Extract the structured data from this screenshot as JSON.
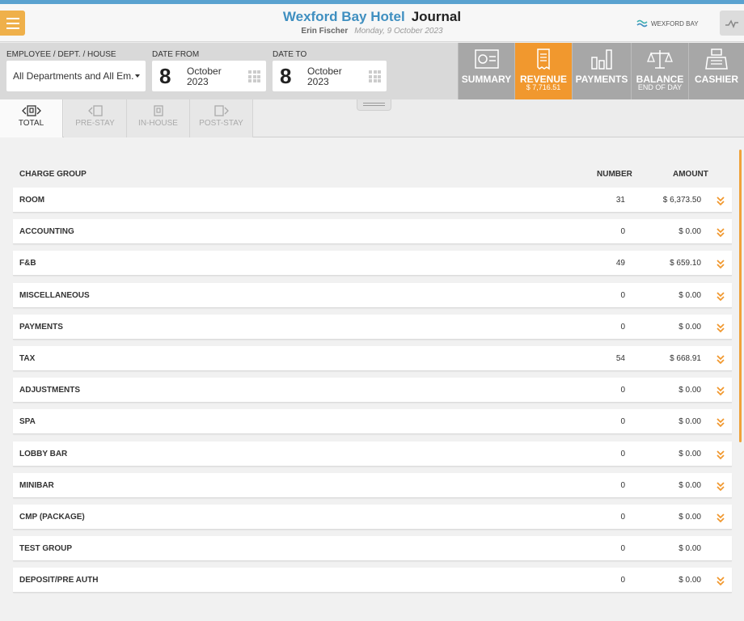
{
  "header": {
    "hotel_name": "Wexford Bay Hotel",
    "page_title": "Journal",
    "user": "Erin Fischer",
    "date": "Monday, 9 October 2023",
    "brand": "WEXFORD BAY",
    "accent_color": "#f1982e",
    "brand_color": "#3f8fc0"
  },
  "filters": {
    "employee_label": "EMPLOYEE / DEPT. / HOUSE",
    "employee_value": "All Departments and All Em.",
    "date_from_label": "DATE FROM",
    "date_from": {
      "day": "8",
      "month": "October",
      "year": "2023"
    },
    "date_to_label": "DATE TO",
    "date_to": {
      "day": "8",
      "month": "October",
      "year": "2023"
    }
  },
  "nav_tabs": [
    {
      "label": "SUMMARY",
      "sub": "",
      "icon": "summary-icon"
    },
    {
      "label": "REVENUE",
      "sub": "$ 7,716.51",
      "icon": "receipt-icon",
      "active": true
    },
    {
      "label": "PAYMENTS",
      "sub": "",
      "icon": "bar-chart-icon"
    },
    {
      "label": "BALANCE",
      "sub": "END OF DAY",
      "icon": "scales-icon"
    },
    {
      "label": "CASHIER",
      "sub": "",
      "icon": "cash-register-icon"
    }
  ],
  "sub_tabs": [
    {
      "label": "TOTAL",
      "active": true
    },
    {
      "label": "PRE-STAY"
    },
    {
      "label": "IN-HOUSE"
    },
    {
      "label": "POST-STAY"
    }
  ],
  "table": {
    "headers": {
      "group": "CHARGE GROUP",
      "number": "NUMBER",
      "amount": "AMOUNT"
    },
    "rows": [
      {
        "name": "ROOM",
        "number": "31",
        "amount": "$ 6,373.50",
        "expandable": true
      },
      {
        "name": "ACCOUNTING",
        "number": "0",
        "amount": "$ 0.00",
        "expandable": true
      },
      {
        "name": "F&B",
        "number": "49",
        "amount": "$ 659.10",
        "expandable": true
      },
      {
        "name": "MISCELLANEOUS",
        "number": "0",
        "amount": "$ 0.00",
        "expandable": true
      },
      {
        "name": "PAYMENTS",
        "number": "0",
        "amount": "$ 0.00",
        "expandable": true
      },
      {
        "name": "TAX",
        "number": "54",
        "amount": "$ 668.91",
        "expandable": true
      },
      {
        "name": "ADJUSTMENTS",
        "number": "0",
        "amount": "$ 0.00",
        "expandable": true
      },
      {
        "name": "SPA",
        "number": "0",
        "amount": "$ 0.00",
        "expandable": true
      },
      {
        "name": "LOBBY BAR",
        "number": "0",
        "amount": "$ 0.00",
        "expandable": true
      },
      {
        "name": "MINIBAR",
        "number": "0",
        "amount": "$ 0.00",
        "expandable": true
      },
      {
        "name": "CMP (PACKAGE)",
        "number": "0",
        "amount": "$ 0.00",
        "expandable": true
      },
      {
        "name": "TEST GROUP",
        "number": "0",
        "amount": "$ 0.00",
        "expandable": false
      },
      {
        "name": "DEPOSIT/PRE AUTH",
        "number": "0",
        "amount": "$ 0.00",
        "expandable": true
      }
    ]
  }
}
